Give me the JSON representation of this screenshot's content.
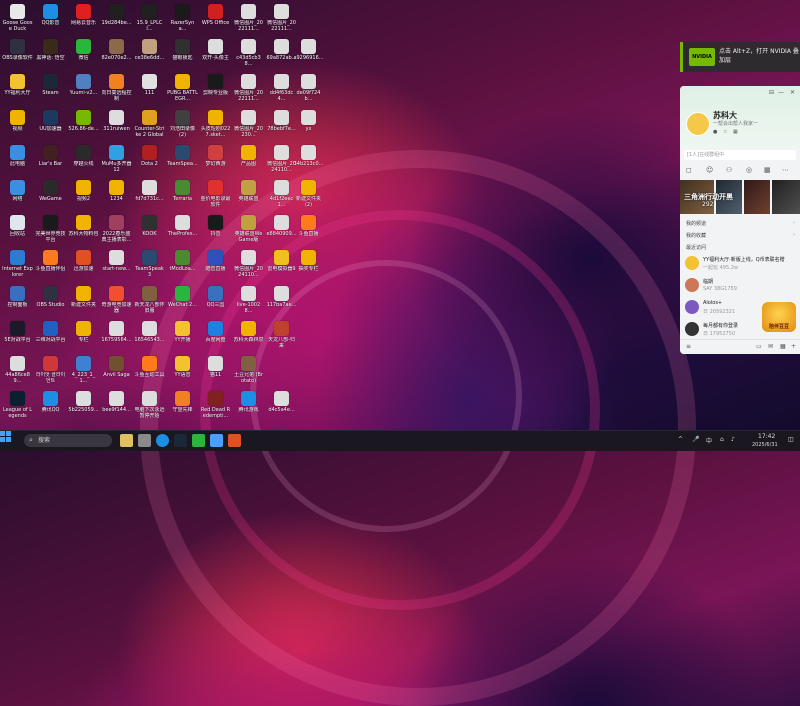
{
  "desktop_icons": [
    {
      "label": "Goose Goose Duck",
      "color": "#e8e8e8"
    },
    {
      "label": "OBS录像软件",
      "color": "#303040"
    },
    {
      "label": "YY福利大厅",
      "color": "#f2c230"
    },
    {
      "label": "视频",
      "color": "#f0b400"
    },
    {
      "label": "此电脑",
      "color": "#3b8fe0"
    },
    {
      "label": "网络",
      "color": "#3b8fe0"
    },
    {
      "label": "回收站",
      "color": "#dfe6ee"
    },
    {
      "label": "Internet Explorer",
      "color": "#2b7cd3"
    },
    {
      "label": "控制面板",
      "color": "#3a6fc0"
    },
    {
      "label": "5E对战平台",
      "color": "#1a1a2a"
    },
    {
      "label": "44a86ce89...",
      "color": "#dddddd"
    },
    {
      "label": "League of Legends",
      "color": "#0a2030"
    },
    {
      "label": "QQ影音",
      "color": "#1a8fe3"
    },
    {
      "label": "黑神话: 悟空",
      "color": "#3a2a1a"
    },
    {
      "label": "Steam",
      "color": "#1b2838"
    },
    {
      "label": "UU加速器",
      "color": "#1a3a60"
    },
    {
      "label": "Liar's Bar",
      "color": "#402020"
    },
    {
      "label": "WeGame",
      "color": "#2a2a2a"
    },
    {
      "label": "完美世界竞技平台",
      "color": "#1a1a1a"
    },
    {
      "label": "斗鱼直播伴侣",
      "color": "#ff7a1a"
    },
    {
      "label": "OBS Studio",
      "color": "#303040"
    },
    {
      "label": "三维对战平台",
      "color": "#2060c0"
    },
    {
      "label": "라이엇 클라이언트",
      "color": "#d13639"
    },
    {
      "label": "腾讯QQ",
      "color": "#1a8fe3"
    },
    {
      "label": "网易云音乐",
      "color": "#e02020"
    },
    {
      "label": "微信",
      "color": "#2ab63c"
    },
    {
      "label": "Yuumi-v2...",
      "color": "#5080c0"
    },
    {
      "label": "526.86-de...",
      "color": "#76b900"
    },
    {
      "label": "穿越火线",
      "color": "#2a2a2a"
    },
    {
      "label": "视频2",
      "color": "#f0b400"
    },
    {
      "label": "苏科大物料包",
      "color": "#f0b400"
    },
    {
      "label": "迅游加速",
      "color": "#e05020"
    },
    {
      "label": "新建文件夹",
      "color": "#f0b400"
    },
    {
      "label": "专栏",
      "color": "#f0b400"
    },
    {
      "label": "4_223_1_1...",
      "color": "#4080d0"
    },
    {
      "label": "5b225059...",
      "color": "#dddddd"
    },
    {
      "label": "19d284be...",
      "color": "#202020"
    },
    {
      "label": "82e070e2...",
      "color": "#8a6a4a"
    },
    {
      "label": "向日葵远程控制",
      "color": "#f08020"
    },
    {
      "label": "311ruiwen",
      "color": "#dddddd"
    },
    {
      "label": "MuMu多开器12",
      "color": "#30a0e0"
    },
    {
      "label": "1234",
      "color": "#f0b400"
    },
    {
      "label": "2022春乐盛典主播表彰...",
      "color": "#a04060"
    },
    {
      "label": "start-new...",
      "color": "#dddddd"
    },
    {
      "label": "奇游电竞加速器",
      "color": "#f05030"
    },
    {
      "label": "16759564...",
      "color": "#dddddd"
    },
    {
      "label": "Anvil Saga",
      "color": "#705030"
    },
    {
      "label": "bee9f144...",
      "color": "#dddddd"
    },
    {
      "label": "15.9_LPLCl...",
      "color": "#202020"
    },
    {
      "label": "ce38e6dd...",
      "color": "#c0a080"
    },
    {
      "label": "111",
      "color": "#e0e0e0"
    },
    {
      "label": "Counter-Strike 2 Global Off...",
      "color": "#e0a020"
    },
    {
      "label": "Dota 2",
      "color": "#b02020"
    },
    {
      "label": "fd7d731c...",
      "color": "#dddddd"
    },
    {
      "label": "KOOK",
      "color": "#303030"
    },
    {
      "label": "TeamSpeak 3",
      "color": "#2a4a70"
    },
    {
      "label": "新天龙八部怀旧服",
      "color": "#806040"
    },
    {
      "label": "16546543...",
      "color": "#dddddd"
    },
    {
      "label": "斗鱼互动工具",
      "color": "#ff7a1a"
    },
    {
      "label": "电脑下次永远暂停开始",
      "color": "#dddddd"
    },
    {
      "label": "RazerSyna...",
      "color": "#1a1a1a"
    },
    {
      "label": "猫眼锁匙",
      "color": "#303030"
    },
    {
      "label": "PUBG BATTLEGR...",
      "color": "#f0b400"
    },
    {
      "label": "刘浩田录像 (2)",
      "color": "#404040"
    },
    {
      "label": "TeamSpea...",
      "color": "#2a4a70"
    },
    {
      "label": "Terraria",
      "color": "#4a8a30"
    },
    {
      "label": "TheProfes...",
      "color": "#dddddd"
    },
    {
      "label": "tModLoa...",
      "color": "#4a8a30"
    },
    {
      "label": "WeChat 2...",
      "color": "#2ab63c"
    },
    {
      "label": "YY开播",
      "color": "#f2c230"
    },
    {
      "label": "YY语音",
      "color": "#f2c230"
    },
    {
      "label": "守望先锋",
      "color": "#f08020"
    },
    {
      "label": "WPS Office",
      "color": "#d02020"
    },
    {
      "label": "双开-头像主",
      "color": "#dddddd"
    },
    {
      "label": "剪映专业版",
      "color": "#1a1a1a"
    },
    {
      "label": "头皮短剧0227.sket...",
      "color": "#f0b400"
    },
    {
      "label": "梦幻西游",
      "color": "#d04040"
    },
    {
      "label": "金价电影录最软件",
      "color": "#e03030"
    },
    {
      "label": "抖音",
      "color": "#1a1a1a"
    },
    {
      "label": "酷音直播",
      "color": "#3050c0"
    },
    {
      "label": "QQ三国",
      "color": "#3a70c0"
    },
    {
      "label": "百度网盘",
      "color": "#2080e0"
    },
    {
      "label": "猫11",
      "color": "#dddddd"
    },
    {
      "label": "Red Dead Redempti...",
      "color": "#802020"
    },
    {
      "label": "微信图片_2022111...",
      "color": "#dddddd"
    },
    {
      "label": "c43d5cb38...",
      "color": "#dddddd"
    },
    {
      "label": "微信图片_2022111...",
      "color": "#dddddd"
    },
    {
      "label": "微信图片_20230...",
      "color": "#dddddd"
    },
    {
      "label": "产品图",
      "color": "#f0b400"
    },
    {
      "label": "英雄联盟",
      "color": "#c0a040"
    },
    {
      "label": "英雄联盟WeGame版",
      "color": "#c0a040"
    },
    {
      "label": "微信图片_2024110...",
      "color": "#dddddd"
    },
    {
      "label": "live-10028...",
      "color": "#dddddd"
    },
    {
      "label": "苏科大森林泉",
      "color": "#f0b400"
    },
    {
      "label": "土豆兄弟 (Brotato)",
      "color": "#806040"
    },
    {
      "label": "腾讯游戏",
      "color": "#1a8fe3"
    },
    {
      "label": "微信图片_2022111...",
      "color": "#dddddd"
    },
    {
      "label": "69a872ab...",
      "color": "#dddddd"
    },
    {
      "label": "dd4f63dc4...",
      "color": "#dddddd"
    },
    {
      "label": "78bebf7e...",
      "color": "#dddddd"
    },
    {
      "label": "微信图片_2024110...",
      "color": "#dddddd"
    },
    {
      "label": "4d1f2eec1...",
      "color": "#dddddd"
    },
    {
      "label": "e8840909...",
      "color": "#dddddd"
    },
    {
      "label": "雷电模拟器9",
      "color": "#f0c020"
    },
    {
      "label": "117ba7ae...",
      "color": "#dddddd"
    },
    {
      "label": "天龙八部-归来",
      "color": "#c04030"
    },
    {
      "label": "",
      "color": "rgba(0,0,0,0)"
    },
    {
      "label": "d4c5a4e...",
      "color": "#dddddd"
    },
    {
      "label": "",
      "color": "rgba(0,0,0,0)"
    },
    {
      "label": "a9296916...",
      "color": "#dddddd"
    },
    {
      "label": "de09f724b...",
      "color": "#dddddd"
    },
    {
      "label": "yx",
      "color": "#dddddd"
    },
    {
      "label": "34b213c0...",
      "color": "#dddddd"
    },
    {
      "label": "新建文件夹 (2)",
      "color": "#f0b400"
    },
    {
      "label": "斗鱼直播",
      "color": "#ff7a1a"
    },
    {
      "label": "抽奖专栏",
      "color": "#f0b400"
    }
  ],
  "nvidia_toast": {
    "logo": "NVIDIA",
    "text": "点击 Alt+Z，打开 NVIDIA 叠加层"
  },
  "qq_panel": {
    "name": "苏科大",
    "signature": "一帮会出帮人我家一",
    "search_placeholder": "[1人]在线群组中",
    "banner_title": "三角洲行动开黑",
    "banner_sub": "292",
    "sec_channels": "我的频道",
    "sec_favorites": "我的收藏",
    "sec_recent": "最近访问",
    "rows": [
      {
        "name": "YY福利大厅·新版上线，Q币表联名赠",
        "sub": "一起玩 495.2w",
        "color": "#f2c230",
        "time": ""
      },
      {
        "name": "临期",
        "sub": "SAY 38G1759",
        "color": "#cc7755",
        "time": ""
      },
      {
        "name": "Alolos+",
        "sub": "日 20592321",
        "color": "#7a5ac0",
        "time": ""
      },
      {
        "name": "每月都有你登录",
        "sub": "日 17952750",
        "color": "#333333",
        "time": ""
      }
    ]
  },
  "pet": {
    "label": "陪伴豆豆"
  },
  "taskbar": {
    "search": "搜索",
    "time": "17:42",
    "date": "2025/6/31",
    "ime": "中"
  }
}
